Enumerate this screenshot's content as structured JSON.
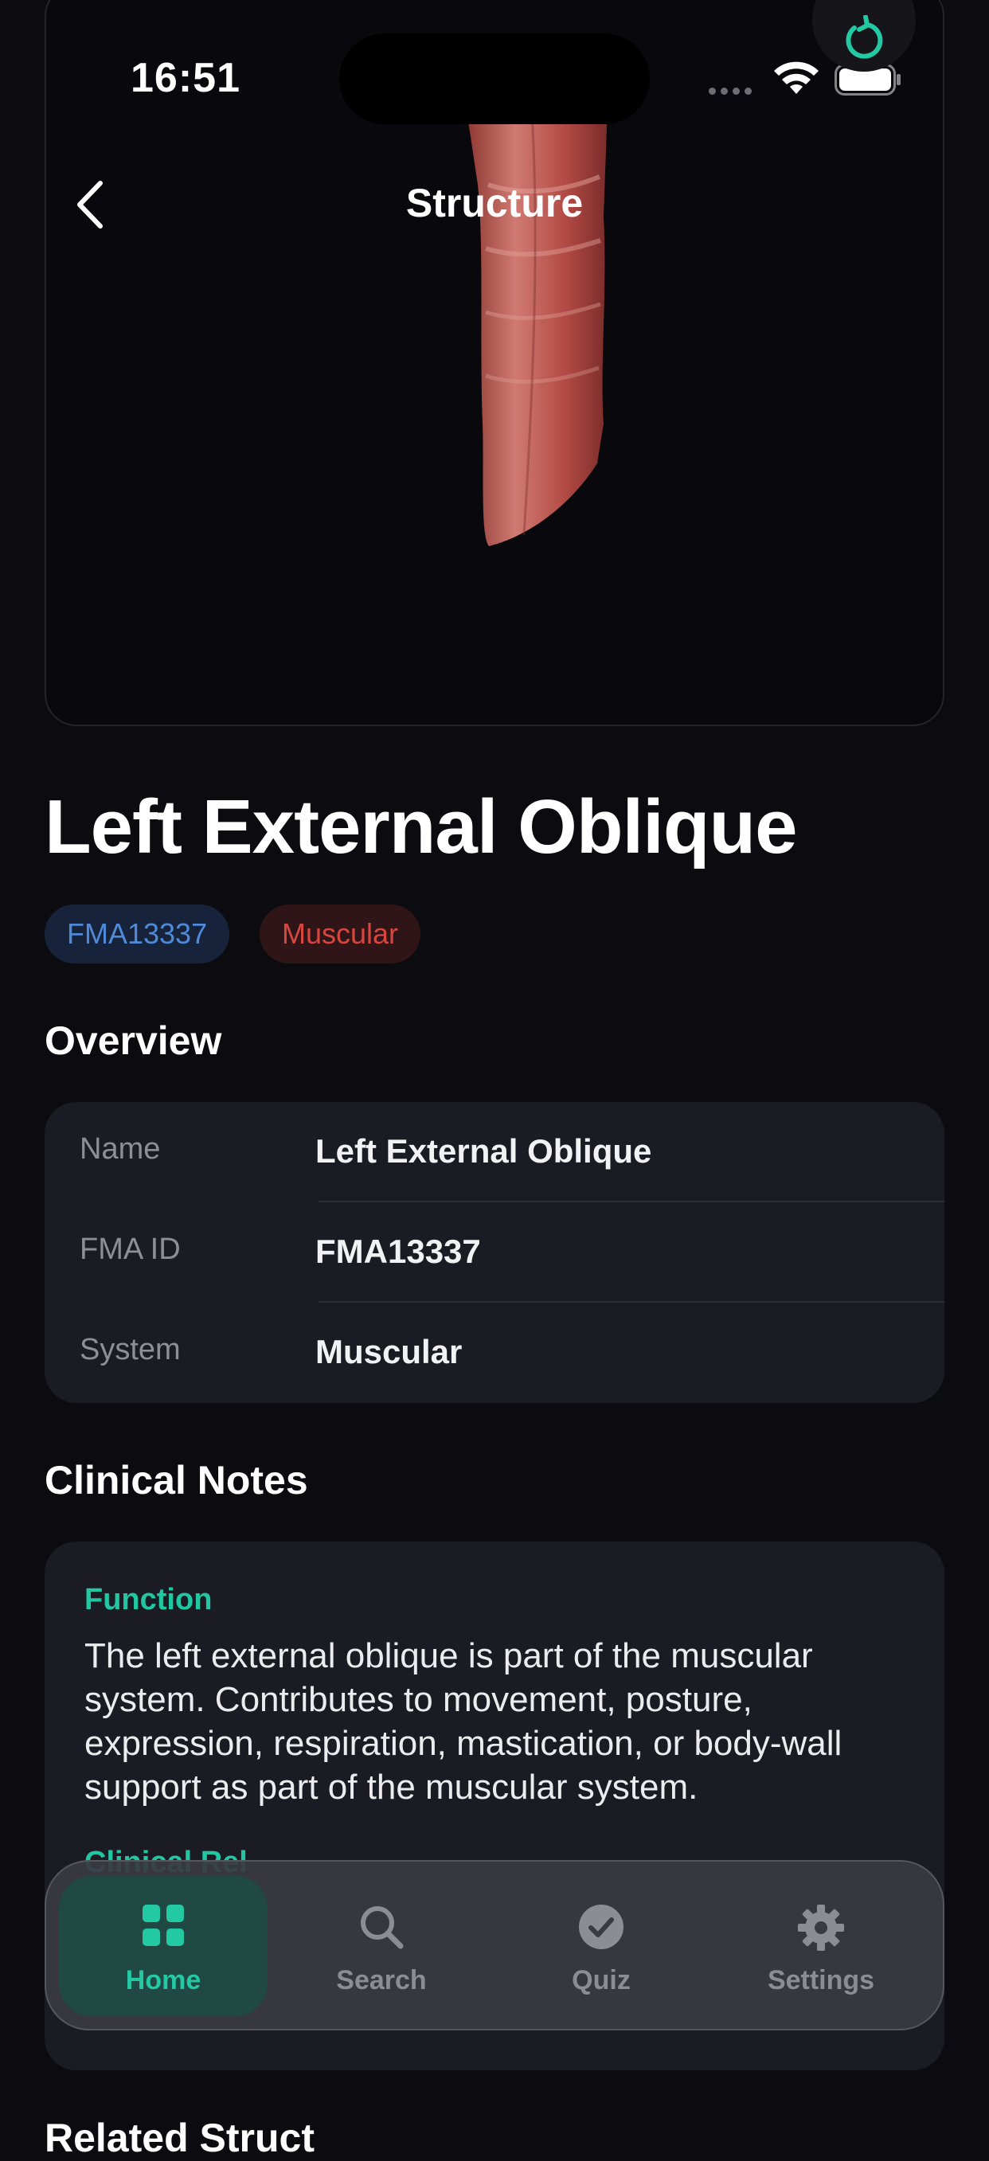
{
  "status_bar": {
    "time": "16:51"
  },
  "nav": {
    "title": "Structure"
  },
  "structure": {
    "title": "Left External Oblique",
    "chips": {
      "fma": "FMA13337",
      "system": "Muscular"
    }
  },
  "overview": {
    "heading": "Overview",
    "rows": [
      {
        "key": "Name",
        "value": "Left External Oblique"
      },
      {
        "key": "FMA ID",
        "value": "FMA13337"
      },
      {
        "key": "System",
        "value": "Muscular"
      }
    ]
  },
  "clinical": {
    "heading": "Clinical Notes",
    "function_label": "Function",
    "function_text": "The left external oblique is part of the muscular system. Contributes to movement, posture, expression, respiration, mastication, or body-wall support as part of the muscular system.",
    "next_label": "Clinical Rel"
  },
  "related": {
    "heading": "Related Struct"
  },
  "tabs": [
    {
      "label": "Home",
      "icon": "grid-icon",
      "active": true
    },
    {
      "label": "Search",
      "icon": "search-icon",
      "active": false
    },
    {
      "label": "Quiz",
      "icon": "checkmark-circle-icon",
      "active": false
    },
    {
      "label": "Settings",
      "icon": "gear-icon",
      "active": false
    }
  ],
  "colors": {
    "accent": "#22c9a3",
    "fma_chip": "#4f8ad9",
    "system_chip": "#d8473f",
    "muscle": "#b5524c"
  }
}
